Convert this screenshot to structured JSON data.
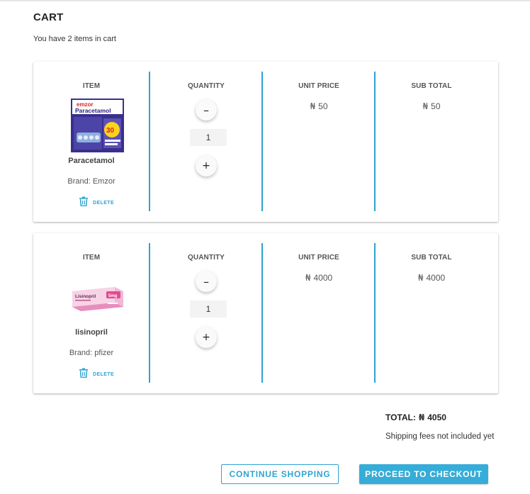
{
  "header": {
    "title": "CART",
    "subtitle": "You have 2 items in cart"
  },
  "columns": {
    "item": "ITEM",
    "quantity": "QUANTITY",
    "unit_price": "UNIT PRICE",
    "sub_total": "SUB TOTAL"
  },
  "currency_symbol": "₦",
  "items": [
    {
      "name": "Paracetamol",
      "brand": "Brand: Emzor",
      "quantity": "1",
      "unit_price": "50",
      "sub_total": "50",
      "image_icon": "paracetamol-pack-image",
      "image_text_line1": "emzor",
      "image_text_line2": "Paracetamol",
      "image_badge": "30",
      "delete_label": "DELETE",
      "minus_label": "–",
      "plus_label": "+"
    },
    {
      "name": "lisinopril",
      "brand": "Brand: pfizer",
      "quantity": "1",
      "unit_price": "4000",
      "sub_total": "4000",
      "image_icon": "lisinopril-pack-image",
      "image_text_line1": "Lisinopril",
      "image_badge": "5mg",
      "delete_label": "DELETE",
      "minus_label": "–",
      "plus_label": "+"
    }
  ],
  "summary": {
    "total_label": "TOTAL:",
    "total_value": "4050",
    "shipping_note": "Shipping fees not included yet"
  },
  "actions": {
    "continue_label": "CONTINUE SHOPPING",
    "checkout_label": "PROCEED TO CHECKOUT"
  },
  "colors": {
    "accent": "#2ea3d3",
    "checkout_bg": "#36acd8"
  }
}
